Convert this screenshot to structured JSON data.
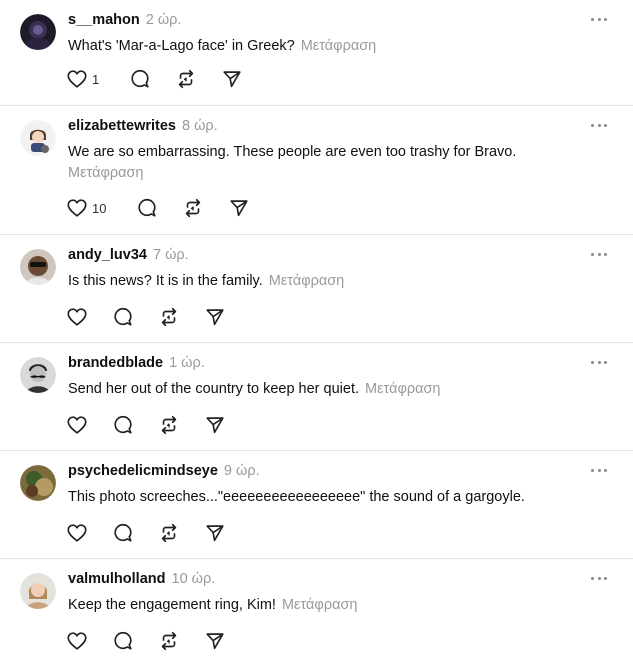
{
  "translate_label": "Μετάφραση",
  "posts": [
    {
      "username": "s__mahon",
      "time": "2 ώρ.",
      "text": "What's 'Mar-a-Lago face' in Greek?",
      "translate": "Μετάφραση",
      "likes": "1",
      "avatar_icon": "dark-avatar-icon"
    },
    {
      "username": "elizabettewrites",
      "time": "8 ώρ.",
      "text": "We are so embarrassing. These people are even too trashy for Bravo.",
      "translate": "Μετάφραση",
      "likes": "10",
      "avatar_icon": "cartoon-avatar-icon"
    },
    {
      "username": "andy_luv34",
      "time": "7 ώρ.",
      "text": "Is this news? It is in the family.",
      "translate": "Μετάφραση",
      "likes": "",
      "avatar_icon": "sunglasses-avatar-icon"
    },
    {
      "username": "brandedblade",
      "time": "1 ώρ.",
      "text": "Send her out of the country to keep her quiet.",
      "translate": "Μετάφραση",
      "likes": "",
      "avatar_icon": "mustache-avatar-icon"
    },
    {
      "username": "psychedelicmindseye",
      "time": "9 ώρ.",
      "text": "This photo screeches...\"eeeeeeeeeeeeeeeee\" the sound of a gargoyle.",
      "translate": "",
      "likes": "",
      "avatar_icon": "photo-avatar-icon"
    },
    {
      "username": "valmulholland",
      "time": "10 ώρ.",
      "text": "Keep the engagement ring, Kim!",
      "translate": "Μετάφραση",
      "likes": "",
      "avatar_icon": "woman-avatar-icon"
    }
  ],
  "colors": {
    "text": "#101010",
    "muted": "#9a9a9a",
    "divider": "#e3e3e3",
    "icon": "#222222"
  }
}
